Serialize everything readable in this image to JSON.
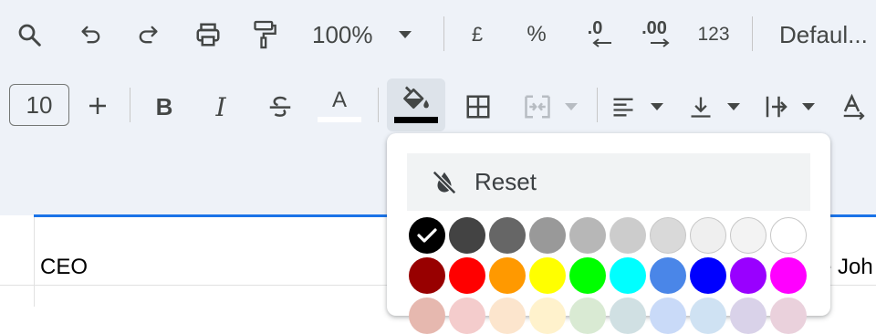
{
  "toolbar_row1": {
    "zoom": "100%",
    "currency": "£",
    "percent": "%",
    "dec_decrease": ".0",
    "dec_increase": ".00",
    "more_formats": "123",
    "font": "Defaul..."
  },
  "toolbar_row2": {
    "font_size": "10",
    "bold": "B",
    "italic": "I",
    "text_color_letter": "A",
    "text_color": "#000000",
    "fill_color": "#000000"
  },
  "sheet": {
    "cell_a": "CEO",
    "cell_b_partial": "e Joh"
  },
  "fill_popup": {
    "reset_label": "Reset",
    "selected_color": "#000000",
    "colors_row1": [
      "#000000",
      "#434343",
      "#666666",
      "#999999",
      "#b7b7b7",
      "#cccccc",
      "#d9d9d9",
      "#efefef",
      "#f3f3f3",
      "#ffffff"
    ],
    "colors_row2": [
      "#980000",
      "#ff0000",
      "#ff9900",
      "#ffff00",
      "#00ff00",
      "#00ffff",
      "#4a86e8",
      "#0000ff",
      "#9900ff",
      "#ff00ff"
    ],
    "colors_row3": [
      "#e6b8af",
      "#f4cccc",
      "#fce5cd",
      "#fff2cc",
      "#d9ead3",
      "#d0e0e3",
      "#c9daf8",
      "#cfe2f3",
      "#d9d2e9",
      "#ead1dc"
    ]
  }
}
